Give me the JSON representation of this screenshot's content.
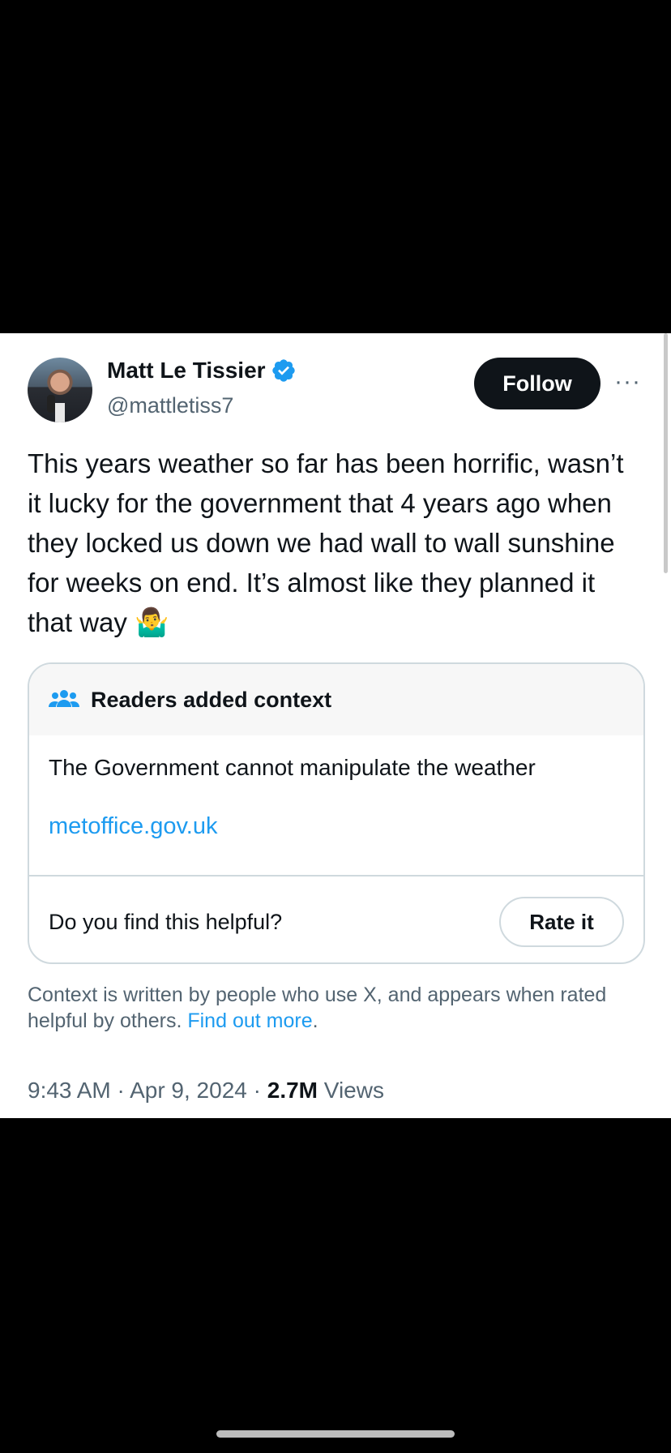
{
  "tweet": {
    "author_name": "Matt Le Tissier",
    "handle": "@mattletiss7",
    "follow_label": "Follow",
    "more_label": "···",
    "text": "This years weather so far has been horrific, wasn’t it lucky for the government that 4 years ago when they locked us down we had wall to wall sunshine for weeks on end. It’s almost like they planned it that way",
    "emoji": "🤷‍♂️"
  },
  "community_note": {
    "title": "Readers added context",
    "body": "The Government cannot manipulate the weather",
    "link": "metoffice.gov.uk",
    "helpful_question": "Do you find this helpful?",
    "rate_label": "Rate it"
  },
  "disclaimer": {
    "text": "Context is written by people who use X, and appears when rated helpful by others.",
    "link": "Find out more",
    "end": "."
  },
  "meta": {
    "time": "9:43 AM",
    "separator": " · ",
    "date": "Apr 9, 2024",
    "views_count": "2.7M",
    "views_label": "Views"
  },
  "colors": {
    "accent": "#1d9bf0",
    "text_primary": "#0f1419",
    "text_secondary": "#536471"
  },
  "icons": {
    "verified": "verified-badge-icon",
    "people": "people-icon",
    "more": "more-options-icon"
  }
}
